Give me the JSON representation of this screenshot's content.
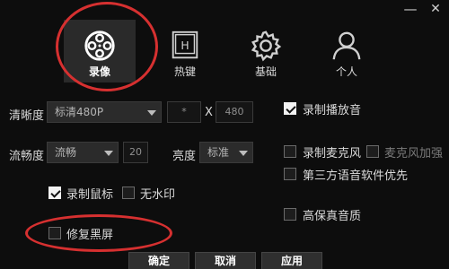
{
  "window": {
    "minimize_label": "—",
    "close_label": "✕"
  },
  "tabs": [
    {
      "label": "录像",
      "icon": "film-reel-icon",
      "active": true
    },
    {
      "label": "热键",
      "icon": "hotkey-h-icon",
      "active": false
    },
    {
      "label": "基础",
      "icon": "gear-icon",
      "active": false
    },
    {
      "label": "个人",
      "icon": "user-icon",
      "active": false
    }
  ],
  "settings": {
    "resolution_label": "清晰度",
    "resolution_value": "标清480P",
    "width_value": "*",
    "times": "X",
    "height_value": "480",
    "fluency_label": "流畅度",
    "fluency_value": "流畅",
    "fps_value": "20",
    "brightness_label": "亮度",
    "brightness_value": "标准",
    "record_mouse": "录制鼠标",
    "no_watermark": "无水印",
    "fix_black_screen": "修复黑屏",
    "record_playback": "录制播放音",
    "record_mic": "录制麦克风",
    "mic_boost": "麦克风加强",
    "third_party_voice": "第三方语音软件优先",
    "hq_audio": "高保真音质"
  },
  "buttons": {
    "ok": "确定",
    "cancel": "取消",
    "apply": "应用"
  },
  "colors": {
    "highlight_ring": "#d63030",
    "background": "#0d0d0d"
  }
}
